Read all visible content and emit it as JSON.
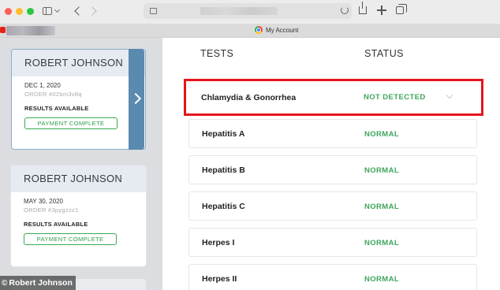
{
  "browser": {
    "tab_title": "My Account"
  },
  "orders": [
    {
      "name": "ROBERT JOHNSON",
      "date": "DEC 1, 2020",
      "order_number": "ORDER #02bm3v8q",
      "results_text": "RESULTS AVAILABLE",
      "payment_label": "PAYMENT COMPLETE",
      "selected": true
    },
    {
      "name": "ROBERT JOHNSON",
      "date": "MAY 30, 2020",
      "order_number": "ORDER #3pygzzz1",
      "results_text": "RESULTS AVAILABLE",
      "payment_label": "PAYMENT COMPLETE",
      "selected": false
    }
  ],
  "results": {
    "tests_header": "TESTS",
    "status_header": "STATUS",
    "rows": [
      {
        "test": "Chlamydia & Gonorrhea",
        "status": "NOT DETECTED",
        "highlighted": true
      },
      {
        "test": "Hepatitis A",
        "status": "NORMAL"
      },
      {
        "test": "Hepatitis B",
        "status": "NORMAL"
      },
      {
        "test": "Hepatitis C",
        "status": "NORMAL"
      },
      {
        "test": "Herpes I",
        "status": "NORMAL"
      },
      {
        "test": "Herpes II",
        "status": "NORMAL"
      }
    ]
  },
  "credit": {
    "symbol": "©",
    "text": "Robert Johnson"
  },
  "colors": {
    "status_green": "#3fa55d",
    "highlight_red": "#e2161c",
    "selected_accent": "#5b8ab0"
  }
}
